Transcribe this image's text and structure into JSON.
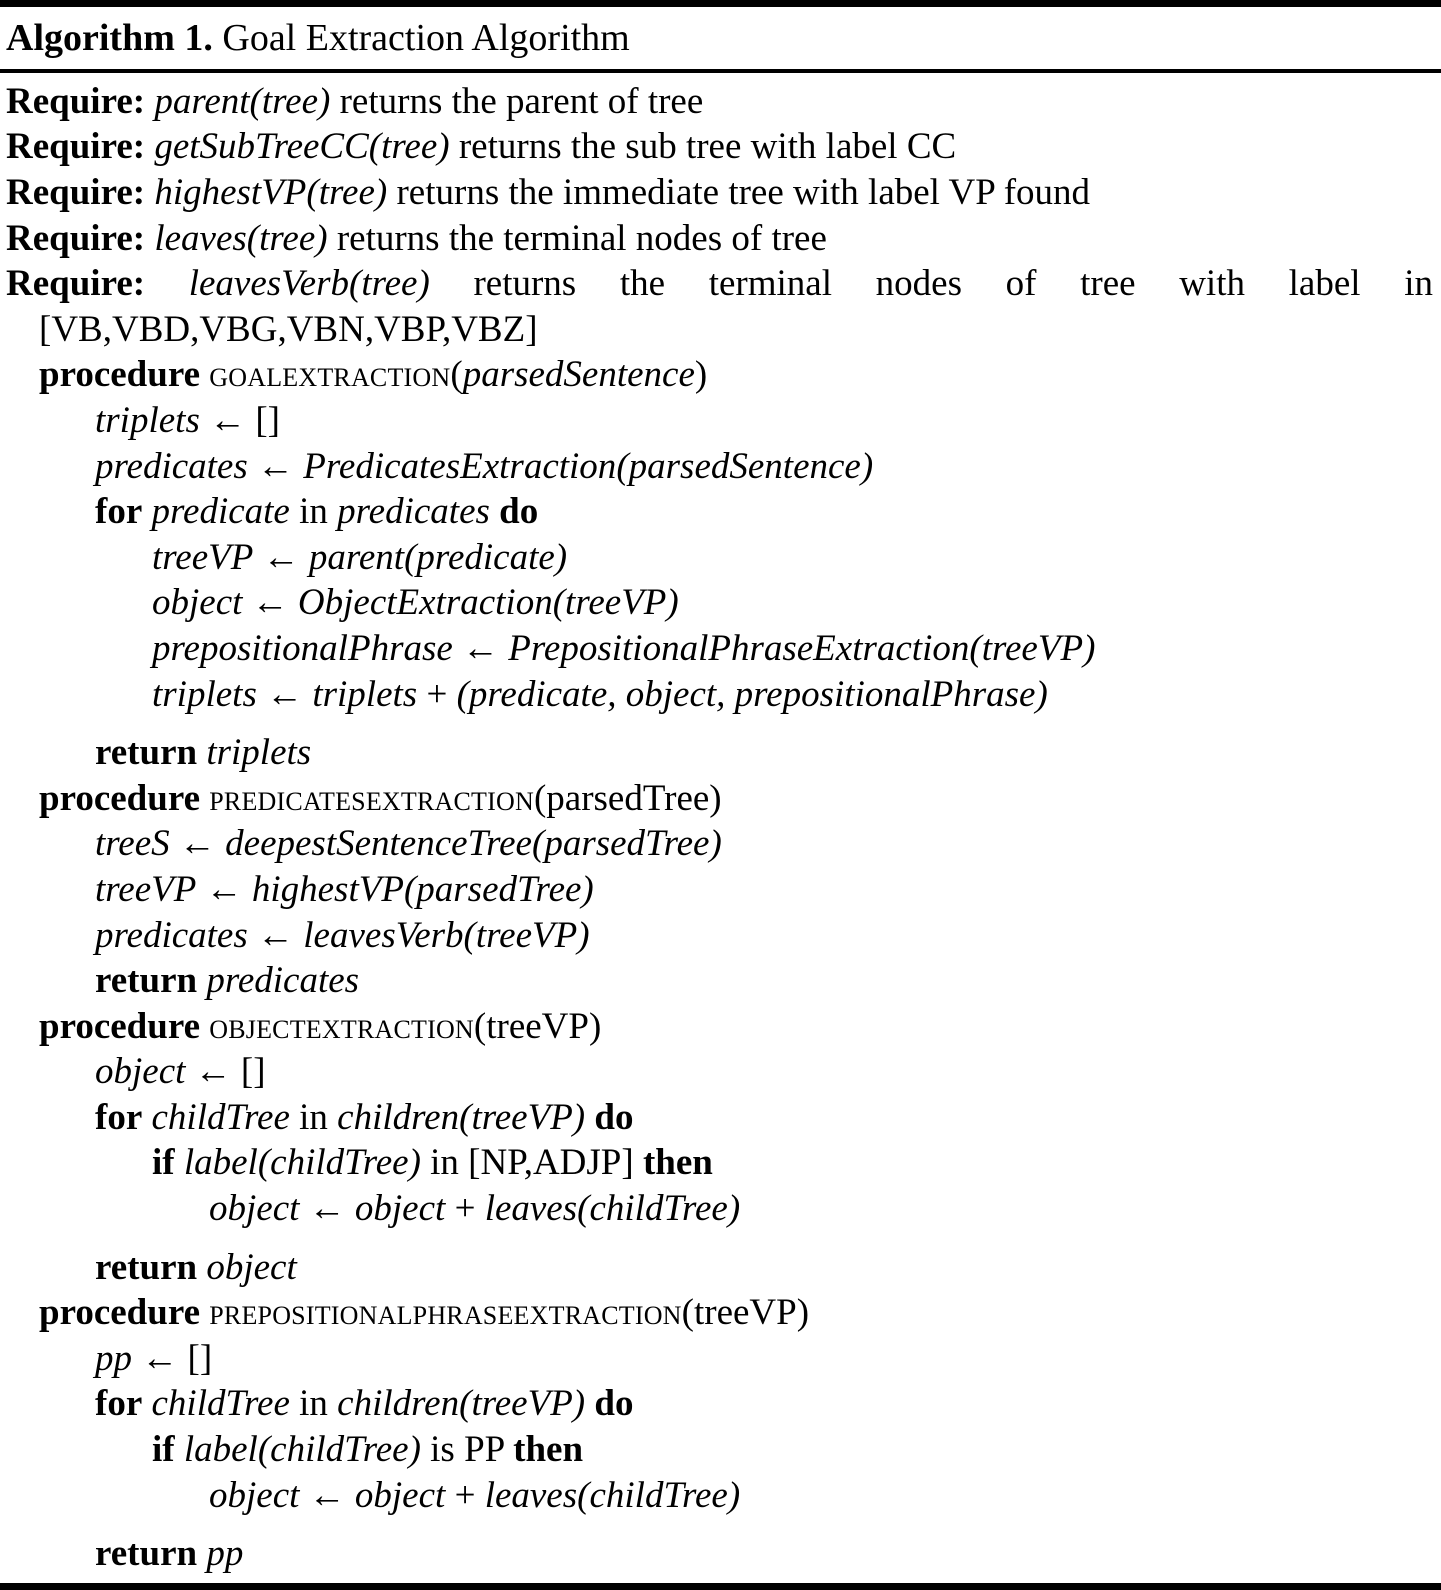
{
  "algorithm": {
    "label": "Algorithm 1.",
    "title": "Goal Extraction Algorithm",
    "requires": [
      {
        "keyword": "Require:",
        "mono": "parent(tree)",
        "text": " returns the parent of tree"
      },
      {
        "keyword": "Require:",
        "mono": "getSubTreeCC(tree)",
        "text": " returns the sub tree with label CC"
      },
      {
        "keyword": "Require:",
        "mono": "highestVP(tree)",
        "text": " returns the immediate tree with label VP found"
      },
      {
        "keyword": "Require:",
        "mono": "leaves(tree)",
        "text": " returns the terminal nodes of tree"
      },
      {
        "keyword": "Require:",
        "mono": "leavesVerb(tree)",
        "text": "returns the terminal nodes of tree with label in",
        "continuation": "[VB,VBD,VBG,VBN,VBP,VBZ]"
      }
    ],
    "procedures": [
      {
        "keyword": "procedure",
        "name": "GoalExtraction",
        "args_open": "(",
        "args": "parsedSentence",
        "args_style": "italic",
        "args_close": ")",
        "lines": [
          {
            "indent": 2,
            "parts": [
              {
                "t": "triplets",
                "s": "it"
              },
              {
                "t": " ← ",
                "s": "arrow"
              },
              {
                "t": "[]",
                "s": "rm"
              }
            ]
          },
          {
            "indent": 2,
            "parts": [
              {
                "t": "predicates",
                "s": "it"
              },
              {
                "t": " ← ",
                "s": "arrow"
              },
              {
                "t": "PredicatesExtraction",
                "s": "it"
              },
              {
                "t": "(",
                "s": "it"
              },
              {
                "t": "parsedSentence",
                "s": "it"
              },
              {
                "t": ")",
                "s": "it"
              }
            ]
          },
          {
            "indent": 2,
            "parts": [
              {
                "t": "for",
                "s": "kw"
              },
              {
                "t": " ",
                "s": "rm"
              },
              {
                "t": "predicate",
                "s": "it"
              },
              {
                "t": " in ",
                "s": "rm"
              },
              {
                "t": "predicates",
                "s": "it"
              },
              {
                "t": " ",
                "s": "rm"
              },
              {
                "t": "do",
                "s": "kw"
              }
            ]
          },
          {
            "indent": 3,
            "parts": [
              {
                "t": "treeVP",
                "s": "it"
              },
              {
                "t": " ← ",
                "s": "arrow"
              },
              {
                "t": "parent",
                "s": "it"
              },
              {
                "t": "(",
                "s": "it"
              },
              {
                "t": "predicate",
                "s": "it"
              },
              {
                "t": ")",
                "s": "it"
              }
            ]
          },
          {
            "indent": 3,
            "parts": [
              {
                "t": "object",
                "s": "it"
              },
              {
                "t": " ← ",
                "s": "arrow"
              },
              {
                "t": "ObjectExtraction",
                "s": "it"
              },
              {
                "t": "(",
                "s": "it"
              },
              {
                "t": "treeVP",
                "s": "it"
              },
              {
                "t": ")",
                "s": "it"
              }
            ]
          },
          {
            "indent": 3,
            "parts": [
              {
                "t": "prepositionalPhrase",
                "s": "it"
              },
              {
                "t": " ← ",
                "s": "arrow"
              },
              {
                "t": "PrepositionalPhraseExtraction",
                "s": "it"
              },
              {
                "t": "(",
                "s": "it"
              },
              {
                "t": "treeVP",
                "s": "it"
              },
              {
                "t": ")",
                "s": "it"
              }
            ]
          },
          {
            "indent": 3,
            "parts": [
              {
                "t": "triplets",
                "s": "it"
              },
              {
                "t": " ← ",
                "s": "arrow"
              },
              {
                "t": "triplets",
                "s": "it"
              },
              {
                "t": " + ",
                "s": "rm"
              },
              {
                "t": "(",
                "s": "it"
              },
              {
                "t": "predicate",
                "s": "it"
              },
              {
                "t": ", ",
                "s": "it"
              },
              {
                "t": "object",
                "s": "it"
              },
              {
                "t": ", ",
                "s": "it"
              },
              {
                "t": "prepositionalPhrase",
                "s": "it"
              },
              {
                "t": ")",
                "s": "it"
              }
            ]
          },
          {
            "indent": 2,
            "gap": true,
            "parts": [
              {
                "t": "return",
                "s": "kw"
              },
              {
                "t": " ",
                "s": "rm"
              },
              {
                "t": "triplets",
                "s": "it"
              }
            ]
          }
        ]
      },
      {
        "keyword": "procedure",
        "name": "PredicatesExtraction",
        "args_open": "(",
        "args": "parsedTree",
        "args_style": "roman",
        "args_close": ")",
        "lines": [
          {
            "indent": 2,
            "parts": [
              {
                "t": "treeS",
                "s": "it"
              },
              {
                "t": " ← ",
                "s": "arrow"
              },
              {
                "t": "deepestSentenceTree",
                "s": "it"
              },
              {
                "t": "(",
                "s": "it"
              },
              {
                "t": "parsedTree",
                "s": "it"
              },
              {
                "t": ")",
                "s": "it"
              }
            ]
          },
          {
            "indent": 2,
            "parts": [
              {
                "t": "treeVP",
                "s": "it"
              },
              {
                "t": " ← ",
                "s": "arrow"
              },
              {
                "t": "highestVP",
                "s": "it"
              },
              {
                "t": "(",
                "s": "it"
              },
              {
                "t": "parsedTree",
                "s": "it"
              },
              {
                "t": ")",
                "s": "it"
              }
            ]
          },
          {
            "indent": 2,
            "parts": [
              {
                "t": "predicates",
                "s": "it"
              },
              {
                "t": " ← ",
                "s": "arrow"
              },
              {
                "t": "leavesVerb",
                "s": "it"
              },
              {
                "t": "(",
                "s": "it"
              },
              {
                "t": "treeVP",
                "s": "it"
              },
              {
                "t": ")",
                "s": "it"
              }
            ]
          },
          {
            "indent": 2,
            "parts": [
              {
                "t": "return",
                "s": "kw"
              },
              {
                "t": " ",
                "s": "rm"
              },
              {
                "t": "predicates",
                "s": "it"
              }
            ]
          }
        ]
      },
      {
        "keyword": "procedure",
        "name": "ObjectExtraction",
        "args_open": "(",
        "args": "treeVP",
        "args_style": "roman",
        "args_close": ")",
        "lines": [
          {
            "indent": 2,
            "parts": [
              {
                "t": "object",
                "s": "it"
              },
              {
                "t": " ← ",
                "s": "arrow"
              },
              {
                "t": "[]",
                "s": "rm"
              }
            ]
          },
          {
            "indent": 2,
            "parts": [
              {
                "t": "for",
                "s": "kw"
              },
              {
                "t": " ",
                "s": "rm"
              },
              {
                "t": "childTree",
                "s": "it"
              },
              {
                "t": " in ",
                "s": "rm"
              },
              {
                "t": "children",
                "s": "it"
              },
              {
                "t": "(",
                "s": "it"
              },
              {
                "t": "treeVP",
                "s": "it"
              },
              {
                "t": ")",
                "s": "it"
              },
              {
                "t": " ",
                "s": "rm"
              },
              {
                "t": "do",
                "s": "kw"
              }
            ]
          },
          {
            "indent": 3,
            "parts": [
              {
                "t": "if",
                "s": "kw"
              },
              {
                "t": " ",
                "s": "rm"
              },
              {
                "t": "label",
                "s": "it"
              },
              {
                "t": "(",
                "s": "it"
              },
              {
                "t": "childTree",
                "s": "it"
              },
              {
                "t": ")",
                "s": "it"
              },
              {
                "t": " in ",
                "s": "rm"
              },
              {
                "t": "[NP,ADJP]",
                "s": "rm"
              },
              {
                "t": " ",
                "s": "rm"
              },
              {
                "t": "then",
                "s": "kw"
              }
            ]
          },
          {
            "indent": 4,
            "parts": [
              {
                "t": "object",
                "s": "it"
              },
              {
                "t": " ← ",
                "s": "arrow"
              },
              {
                "t": "object",
                "s": "it"
              },
              {
                "t": " + ",
                "s": "rm"
              },
              {
                "t": "leaves",
                "s": "it"
              },
              {
                "t": "(",
                "s": "it"
              },
              {
                "t": "childTree",
                "s": "it"
              },
              {
                "t": ")",
                "s": "it"
              }
            ]
          },
          {
            "indent": 2,
            "gap": true,
            "parts": [
              {
                "t": "return",
                "s": "kw"
              },
              {
                "t": " ",
                "s": "rm"
              },
              {
                "t": "object",
                "s": "it"
              }
            ]
          }
        ]
      },
      {
        "keyword": "procedure",
        "name": "PrepositionalPhraseExtraction",
        "args_open": "(",
        "args": "treeVP",
        "args_style": "roman",
        "args_close": ")",
        "lines": [
          {
            "indent": 2,
            "parts": [
              {
                "t": "pp",
                "s": "it"
              },
              {
                "t": " ← ",
                "s": "arrow"
              },
              {
                "t": "[]",
                "s": "rm"
              }
            ]
          },
          {
            "indent": 2,
            "parts": [
              {
                "t": "for",
                "s": "kw"
              },
              {
                "t": " ",
                "s": "rm"
              },
              {
                "t": "childTree",
                "s": "it"
              },
              {
                "t": " in ",
                "s": "rm"
              },
              {
                "t": "children",
                "s": "it"
              },
              {
                "t": "(",
                "s": "it"
              },
              {
                "t": "treeVP",
                "s": "it"
              },
              {
                "t": ")",
                "s": "it"
              },
              {
                "t": " ",
                "s": "rm"
              },
              {
                "t": "do",
                "s": "kw"
              }
            ]
          },
          {
            "indent": 3,
            "parts": [
              {
                "t": "if",
                "s": "kw"
              },
              {
                "t": " ",
                "s": "rm"
              },
              {
                "t": "label",
                "s": "it"
              },
              {
                "t": "(",
                "s": "it"
              },
              {
                "t": "childTree",
                "s": "it"
              },
              {
                "t": ")",
                "s": "it"
              },
              {
                "t": " is ",
                "s": "rm"
              },
              {
                "t": "PP",
                "s": "rm"
              },
              {
                "t": " ",
                "s": "rm"
              },
              {
                "t": "then",
                "s": "kw"
              }
            ]
          },
          {
            "indent": 4,
            "parts": [
              {
                "t": "object",
                "s": "it"
              },
              {
                "t": " ← ",
                "s": "arrow"
              },
              {
                "t": "object",
                "s": "it"
              },
              {
                "t": " + ",
                "s": "rm"
              },
              {
                "t": "leaves",
                "s": "it"
              },
              {
                "t": "(",
                "s": "it"
              },
              {
                "t": "childTree",
                "s": "it"
              },
              {
                "t": ")",
                "s": "it"
              }
            ]
          },
          {
            "indent": 2,
            "gap": true,
            "parts": [
              {
                "t": "return",
                "s": "kw"
              },
              {
                "t": " ",
                "s": "rm"
              },
              {
                "t": "pp",
                "s": "it"
              }
            ]
          }
        ]
      }
    ]
  }
}
